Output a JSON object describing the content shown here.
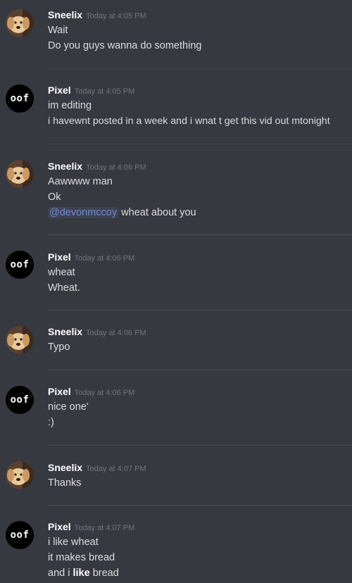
{
  "messages": [
    {
      "author": "Sneelix",
      "avatar": "dog-photo-avatar",
      "timestamp": "Today at 4:05 PM",
      "lines": [
        "Wait",
        "Do you guys wanna do something"
      ]
    },
    {
      "author": "Pixel",
      "avatar": "oof-avatar",
      "avatar_text": "oof",
      "timestamp": "Today at 4:05 PM",
      "lines": [
        "im editing",
        "i havewnt posted in a week and i wnat t get this vid out mtonight"
      ]
    },
    {
      "author": "Sneelix",
      "avatar": "dog-photo-avatar",
      "timestamp": "Today at 4:06 PM",
      "lines": [
        "Aawwww man",
        "Ok"
      ],
      "mention": "@devonmccoy",
      "mention_tail": " wheat about you"
    },
    {
      "author": "Pixel",
      "avatar": "oof-avatar",
      "avatar_text": "oof",
      "timestamp": "Today at 4:06 PM",
      "lines": [
        "wheat",
        "Wheat."
      ]
    },
    {
      "author": "Sneelix",
      "avatar": "dog-photo-avatar",
      "timestamp": "Today at 4:06 PM",
      "lines": [
        "Typo"
      ]
    },
    {
      "author": "Pixel",
      "avatar": "oof-avatar",
      "avatar_text": "oof",
      "timestamp": "Today at 4:06 PM",
      "lines": [
        "nice one'",
        ":)"
      ]
    },
    {
      "author": "Sneelix",
      "avatar": "dog-photo-avatar",
      "timestamp": "Today at 4:07 PM",
      "lines": [
        "Thanks"
      ]
    },
    {
      "author": "Pixel",
      "avatar": "oof-avatar",
      "avatar_text": "oof",
      "timestamp": "Today at 4:07 PM",
      "lines": [
        "i like wheat",
        "it makes bread"
      ],
      "last_line": {
        "pre": "and i ",
        "bold": "like",
        "post": " bread"
      }
    }
  ],
  "colors": {
    "background": "#36393f",
    "divider": "#474a50",
    "username": "#ffffff",
    "timestamp": "#72767d",
    "text": "#dcddde",
    "mention": "#7289da"
  }
}
